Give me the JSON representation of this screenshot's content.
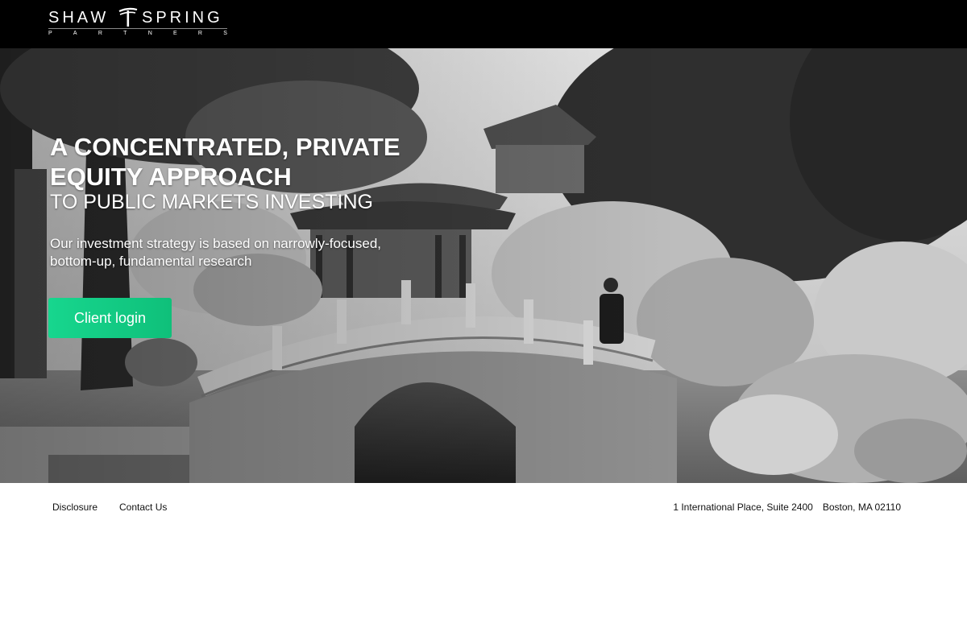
{
  "header": {
    "logo": {
      "word_left": "SHAW",
      "word_right": "SPRING",
      "subtitle_letters": [
        "P",
        "A",
        "R",
        "T",
        "N",
        "E",
        "R",
        "S"
      ],
      "mark_icon": "tree-stake-icon"
    }
  },
  "hero": {
    "headline_line1": "A CONCENTRATED, PRIVATE",
    "headline_line2": "EQUITY APPROACH",
    "subheadline": "TO PUBLIC MARKETS INVESTING",
    "tagline_line1": "Our investment strategy is based on narrowly-focused,",
    "tagline_line2": "bottom-up, fundamental research",
    "login_label": "Client login",
    "image": "black-and-white photo of a stone arch bridge in a classical Chinese garden"
  },
  "footer": {
    "links": [
      "Disclosure",
      "Contact Us"
    ],
    "address_street": "1 International Place, Suite 2400",
    "address_city": "Boston, MA 02110"
  },
  "colors": {
    "header_bg": "#000000",
    "button_green": "#12cc85",
    "footer_bg": "#ffffff",
    "text_dark": "#111111"
  }
}
